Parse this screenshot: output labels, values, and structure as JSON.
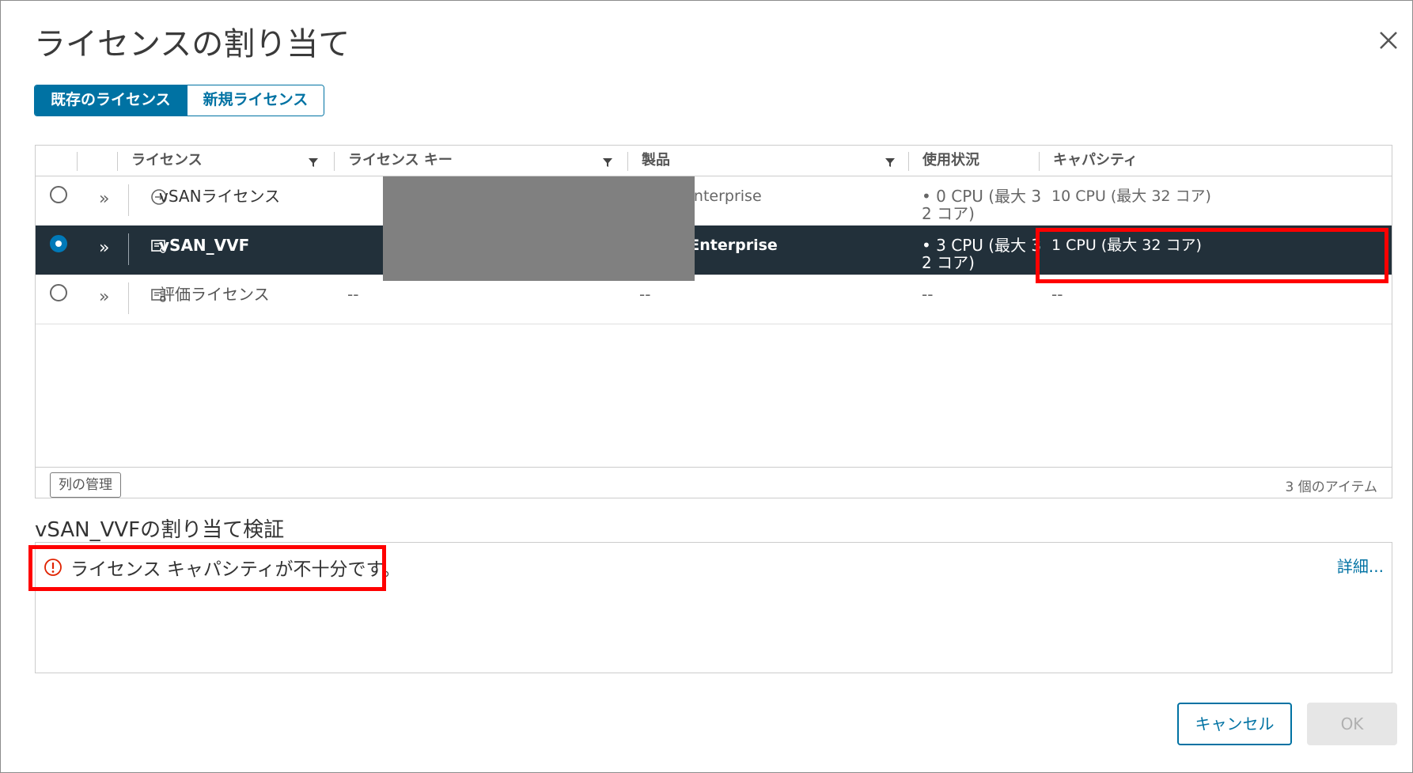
{
  "dialog": {
    "title": "ライセンスの割り当て",
    "close_icon": "close-icon"
  },
  "tabs": [
    {
      "label": "既存のライセンス",
      "active": true
    },
    {
      "label": "新規ライセンス",
      "active": false
    }
  ],
  "grid": {
    "columns": [
      "ライセンス",
      "ライセンス キー",
      "製品",
      "使用状況",
      "キャパシティ"
    ],
    "rows": [
      {
        "selected": false,
        "icon": "license-assign-icon",
        "license": "vSANライセンス",
        "license_key": "",
        "product": "vSAN Enterprise",
        "usage": "• 0 CPU (最大 3 2 コア)",
        "capacity": "10 CPU (最大 32 コア)"
      },
      {
        "selected": true,
        "icon": "license-icon",
        "license": "vSAN_VVF",
        "license_key": "",
        "product": "vSAN Enterprise",
        "usage": "• 3 CPU (最大 3 2 コア)",
        "capacity": "1 CPU (最大 32 コア)"
      },
      {
        "selected": false,
        "icon": "license-icon",
        "license": "評価ライセンス",
        "license_key": "--",
        "product": "--",
        "usage": "--",
        "capacity": "--"
      }
    ],
    "manage_columns_label": "列の管理",
    "item_count": "3 個のアイテム"
  },
  "validation": {
    "title": "vSAN_VVFの割り当て検証",
    "message": "ライセンス キャパシティが不十分です。",
    "details_label": "詳細...",
    "warn_color": "#e02200"
  },
  "buttons": {
    "cancel": "キャンセル",
    "ok": "OK"
  },
  "colors": {
    "accent": "#0072a3",
    "selected_row": "#22303a",
    "highlight": "#ff0000"
  }
}
